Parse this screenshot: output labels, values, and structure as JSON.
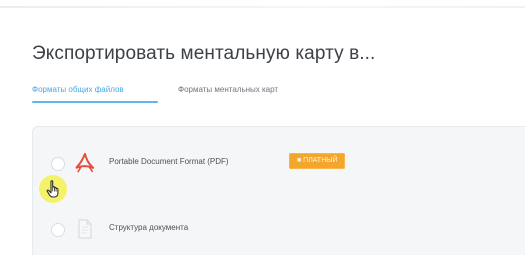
{
  "dialog": {
    "title": "Экспортировать ментальную карту в..."
  },
  "tabs": [
    {
      "label": "Форматы общих файлов",
      "active": true
    },
    {
      "label": "Форматы ментальных карт",
      "active": false
    }
  ],
  "formats": [
    {
      "label": "Portable Document Format (PDF)",
      "icon": "pdf-icon",
      "badge": "■ ПЛАТНЫЙ"
    },
    {
      "label": "Структура документа",
      "icon": "document-outline-icon"
    }
  ],
  "colors": {
    "accent": "#4aa8e6",
    "badge": "#f4a52b",
    "pdf_icon": "#e84c3d",
    "cursor_highlight": "#f3f15b",
    "panel_background": "#f4f6f8"
  },
  "cursor": {
    "type": "hand-pointer",
    "highlight": "yellow-circle"
  }
}
